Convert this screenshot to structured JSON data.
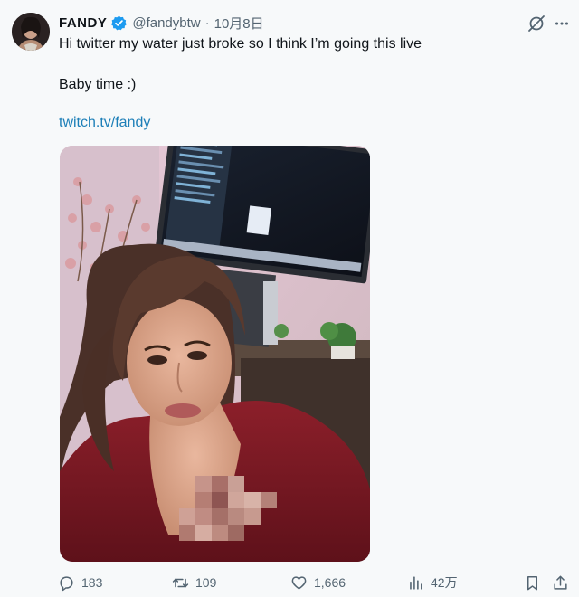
{
  "tweet": {
    "author": {
      "display_name": "FANDY",
      "handle": "@fandybtw",
      "verified": true,
      "avatar_icon": "avatar-image"
    },
    "separator": "·",
    "date": "10月8日",
    "text_lines": [
      "Hi twitter my water just broke so I think I’m going this live",
      "Baby time :)"
    ],
    "link": "twitch.tv/fandy",
    "media": {
      "type": "photo",
      "description_icon": "selfie-photo"
    },
    "metrics": {
      "replies": "183",
      "retweets": "109",
      "likes": "1,666",
      "views": "42万"
    },
    "icons": {
      "grok": "grok-icon",
      "more": "more-icon",
      "reply": "reply-icon",
      "retweet": "retweet-icon",
      "like": "heart-icon",
      "views": "views-icon",
      "bookmark": "bookmark-icon",
      "share": "share-icon"
    },
    "colors": {
      "link": "#1d7fb8",
      "verified": "#1d9bf0",
      "muted": "#536471",
      "text": "#0f1419"
    }
  }
}
